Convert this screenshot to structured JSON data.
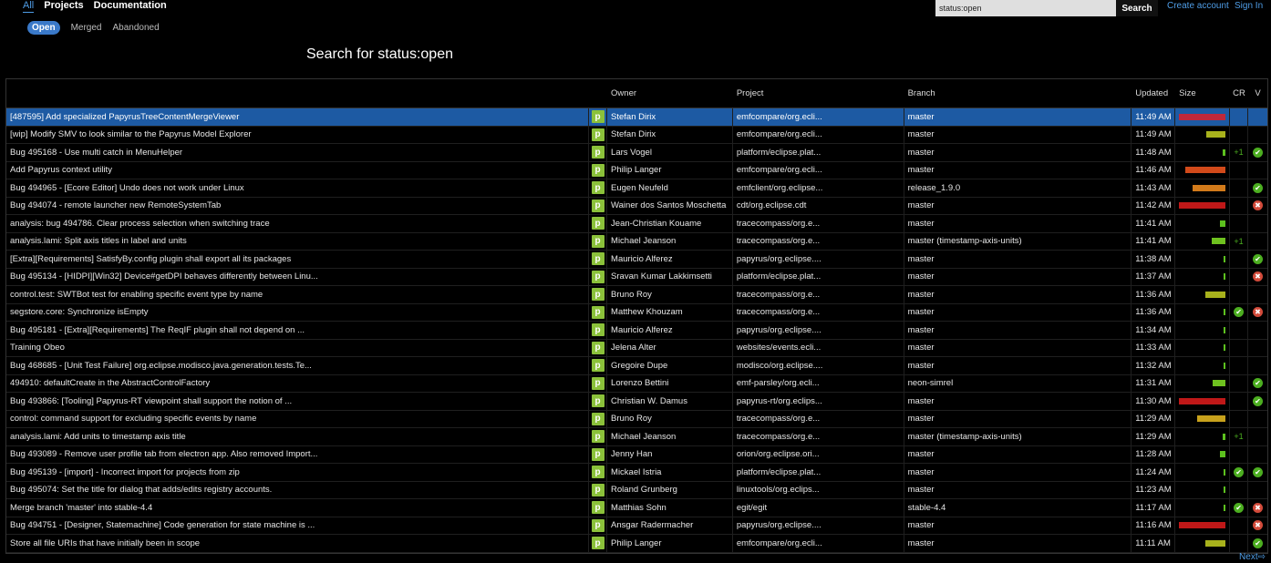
{
  "nav": {
    "tabs": [
      {
        "label": "All",
        "active": true
      },
      {
        "label": "Projects"
      },
      {
        "label": "Documentation"
      }
    ],
    "subtabs": [
      {
        "label": "Open",
        "active": true
      },
      {
        "label": "Merged"
      },
      {
        "label": "Abandoned"
      }
    ]
  },
  "search": {
    "value": "status:open",
    "button": "Search"
  },
  "links": {
    "create_account": "Create account",
    "sign_in": "Sign In"
  },
  "title": "Search for status:open",
  "columns": {
    "owner": "Owner",
    "project": "Project",
    "branch": "Branch",
    "updated": "Updated",
    "size": "Size",
    "cr": "CR",
    "v": "V"
  },
  "icon_char": "p",
  "colors": {
    "accent": "#3a79c9",
    "link": "#4f9de6",
    "selected_row": "#1d5aa3",
    "ok": "#4cae20",
    "reject": "#d24a3a",
    "plus_icon": "#8bc13a"
  },
  "changes": [
    {
      "subject": "[487595] Add specialized PapyrusTreeContentMergeViewer",
      "owner": "Stefan Dirix",
      "project": "emfcompare/org.ecli...",
      "branch": "master",
      "updated": "11:49 AM",
      "size": {
        "frac": 1.0,
        "color": "#c0283a"
      },
      "cr": "",
      "v": "",
      "selected": true
    },
    {
      "subject": "[wip] Modify SMV to look similar to the Papyrus Model Explorer",
      "owner": "Stefan Dirix",
      "project": "emfcompare/org.ecli...",
      "branch": "master",
      "updated": "11:49 AM",
      "size": {
        "frac": 0.4,
        "color": "#a8b21c"
      },
      "cr": "",
      "v": ""
    },
    {
      "subject": "Bug 495168 - Use multi catch in MenuHelper",
      "owner": "Lars Vogel",
      "project": "platform/eclipse.plat...",
      "branch": "master",
      "updated": "11:48 AM",
      "size": {
        "frac": 0.05,
        "color": "#5dc11f"
      },
      "cr": "+1",
      "v": "ok"
    },
    {
      "subject": "Add Papyrus context utility",
      "owner": "Philip Langer",
      "project": "emfcompare/org.ecli...",
      "branch": "master",
      "updated": "11:46 AM",
      "size": {
        "frac": 0.85,
        "color": "#d24a1a"
      },
      "cr": "",
      "v": ""
    },
    {
      "subject": "Bug 494965 - [Ecore Editor] Undo does not work under Linux",
      "owner": "Eugen Neufeld",
      "project": "emfclient/org.eclipse...",
      "branch": "release_1.9.0",
      "updated": "11:43 AM",
      "size": {
        "frac": 0.7,
        "color": "#d27a1a"
      },
      "cr": "",
      "v": "ok"
    },
    {
      "subject": "Bug 494074 - remote launcher new RemoteSystemTab",
      "owner": "Wainer dos Santos Moschetta",
      "project": "cdt/org.eclipse.cdt",
      "branch": "master",
      "updated": "11:42 AM",
      "size": {
        "frac": 1.0,
        "color": "#c01818"
      },
      "cr": "",
      "v": "rej"
    },
    {
      "subject": "analysis: bug 494786. Clear process selection when switching trace",
      "owner": "Jean-Christian Kouame",
      "project": "tracecompass/org.e...",
      "branch": "master",
      "updated": "11:41 AM",
      "size": {
        "frac": 0.12,
        "color": "#5dc11f"
      },
      "cr": "",
      "v": ""
    },
    {
      "subject": "analysis.lami: Split axis titles in label and units",
      "owner": "Michael Jeanson",
      "project": "tracecompass/org.e...",
      "branch": "master (timestamp-axis-units)",
      "updated": "11:41 AM",
      "size": {
        "frac": 0.28,
        "color": "#6ec11f"
      },
      "cr": "+1",
      "v": ""
    },
    {
      "subject": "[Extra][Requirements] SatisfyBy.config plugin shall export all its packages",
      "owner": "Mauricio Alferez",
      "project": "papyrus/org.eclipse....",
      "branch": "master",
      "updated": "11:38 AM",
      "size": {
        "frac": 0.03,
        "color": "#5dc11f"
      },
      "cr": "",
      "v": "ok"
    },
    {
      "subject": "Bug 495134 - [HIDPI][Win32] Device#getDPI behaves differently between Linu...",
      "owner": "Sravan Kumar Lakkimsetti",
      "project": "platform/eclipse.plat...",
      "branch": "master",
      "updated": "11:37 AM",
      "size": {
        "frac": 0.03,
        "color": "#5dc11f"
      },
      "cr": "",
      "v": "rej"
    },
    {
      "subject": "control.test: SWTBot test for enabling specific event type by name",
      "owner": "Bruno Roy",
      "project": "tracecompass/org.e...",
      "branch": "master",
      "updated": "11:36 AM",
      "size": {
        "frac": 0.42,
        "color": "#a8b21c"
      },
      "cr": "",
      "v": ""
    },
    {
      "subject": "segstore.core: Synchronize isEmpty",
      "owner": "Matthew Khouzam",
      "project": "tracecompass/org.e...",
      "branch": "master",
      "updated": "11:36 AM",
      "size": {
        "frac": 0.03,
        "color": "#5dc11f"
      },
      "cr": "ok",
      "v": "rej"
    },
    {
      "subject": "Bug 495181 - [Extra][Requirements] The ReqIF plugin shall not depend on ...",
      "owner": "Mauricio Alferez",
      "project": "papyrus/org.eclipse....",
      "branch": "master",
      "updated": "11:34 AM",
      "size": {
        "frac": 0.03,
        "color": "#5dc11f"
      },
      "cr": "",
      "v": ""
    },
    {
      "subject": "Training Obeo",
      "owner": "Jelena Alter",
      "project": "websites/events.ecli...",
      "branch": "master",
      "updated": "11:33 AM",
      "size": {
        "frac": 0.03,
        "color": "#5dc11f"
      },
      "cr": "",
      "v": ""
    },
    {
      "subject": "Bug 468685 - [Unit Test Failure] org.eclipse.modisco.java.generation.tests.Te...",
      "owner": "Gregoire Dupe",
      "project": "modisco/org.eclipse....",
      "branch": "master",
      "updated": "11:32 AM",
      "size": {
        "frac": 0.03,
        "color": "#5dc11f"
      },
      "cr": "",
      "v": ""
    },
    {
      "subject": "494910: defaultCreate in the AbstractControlFactory",
      "owner": "Lorenzo Bettini",
      "project": "emf-parsley/org.ecli...",
      "branch": "neon-simrel",
      "updated": "11:31 AM",
      "size": {
        "frac": 0.26,
        "color": "#6ec11f"
      },
      "cr": "",
      "v": "ok"
    },
    {
      "subject": "Bug 493866: [Tooling] Papyrus-RT viewpoint shall support the notion of ...",
      "owner": "Christian W. Damus",
      "project": "papyrus-rt/org.eclips...",
      "branch": "master",
      "updated": "11:30 AM",
      "size": {
        "frac": 1.0,
        "color": "#c01818"
      },
      "cr": "",
      "v": "ok"
    },
    {
      "subject": "control: command support for excluding specific events by name",
      "owner": "Bruno Roy",
      "project": "tracecompass/org.e...",
      "branch": "master",
      "updated": "11:29 AM",
      "size": {
        "frac": 0.6,
        "color": "#c8a21c"
      },
      "cr": "",
      "v": ""
    },
    {
      "subject": "analysis.lami: Add units to timestamp axis title",
      "owner": "Michael Jeanson",
      "project": "tracecompass/org.e...",
      "branch": "master (timestamp-axis-units)",
      "updated": "11:29 AM",
      "size": {
        "frac": 0.06,
        "color": "#5dc11f"
      },
      "cr": "+1",
      "v": ""
    },
    {
      "subject": "Bug 493089 - Remove user profile tab from electron app. Also removed Import...",
      "owner": "Jenny Han",
      "project": "orion/org.eclipse.ori...",
      "branch": "master",
      "updated": "11:28 AM",
      "size": {
        "frac": 0.12,
        "color": "#5dc11f"
      },
      "cr": "",
      "v": ""
    },
    {
      "subject": "Bug 495139 - [import] - Incorrect import for projects from zip",
      "owner": "Mickael Istria",
      "project": "platform/eclipse.plat...",
      "branch": "master",
      "updated": "11:24 AM",
      "size": {
        "frac": 0.03,
        "color": "#5dc11f"
      },
      "cr": "ok",
      "v": "ok"
    },
    {
      "subject": "Bug 495074: Set the title for dialog that adds/edits registry accounts.",
      "owner": "Roland Grunberg",
      "project": "linuxtools/org.eclips...",
      "branch": "master",
      "updated": "11:23 AM",
      "size": {
        "frac": 0.03,
        "color": "#5dc11f"
      },
      "cr": "",
      "v": ""
    },
    {
      "subject": "Merge branch 'master' into stable-4.4",
      "owner": "Matthias Sohn",
      "project": "egit/egit",
      "branch": "stable-4.4",
      "updated": "11:17 AM",
      "size": {
        "frac": 0.03,
        "color": "#5dc11f"
      },
      "cr": "ok",
      "v": "rej"
    },
    {
      "subject": "Bug 494751 - [Designer, Statemachine] Code generation for state machine is ...",
      "owner": "Ansgar Radermacher",
      "project": "papyrus/org.eclipse....",
      "branch": "master",
      "updated": "11:16 AM",
      "size": {
        "frac": 1.0,
        "color": "#c01818"
      },
      "cr": "",
      "v": "rej"
    },
    {
      "subject": "Store all file URIs that have initially been in scope",
      "owner": "Philip Langer",
      "project": "emfcompare/org.ecli...",
      "branch": "master",
      "updated": "11:11 AM",
      "size": {
        "frac": 0.42,
        "color": "#a8b21c"
      },
      "cr": "",
      "v": "ok"
    }
  ],
  "next": "Next⇨"
}
